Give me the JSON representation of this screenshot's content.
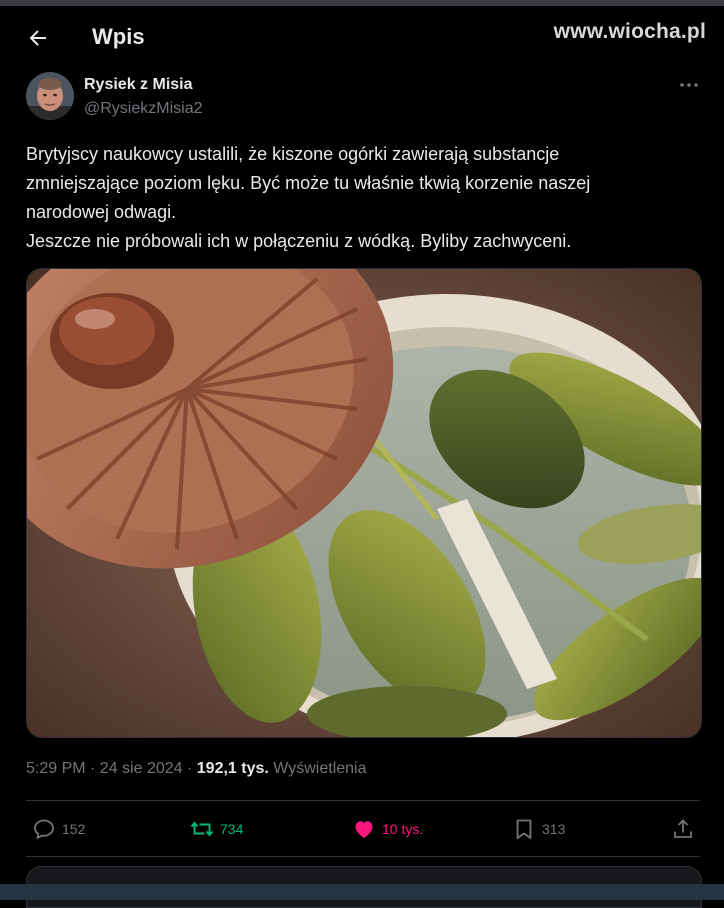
{
  "header": {
    "title": "Wpis",
    "watermark": "www.wiocha.pl"
  },
  "tweet": {
    "author_name": "Rysiek z Misia",
    "author_handle": "@RysiekzMisia2",
    "text_lines": [
      "Brytyjscy naukowcy ustalili, że kiszone ogórki zawierają substancje",
      "zmniejszające poziom lęku. Być może tu właśnie tkwią korzenie naszej",
      "narodowej odwagi.",
      "Jeszcze nie próbowali ich w połączeniu z wódką. Byliby zachwyceni."
    ],
    "timestamp": "5:29 PM · 24 sie 2024 ·",
    "views_count": "192,1 tys.",
    "views_label": "Wyświetlenia"
  },
  "actions": {
    "replies": "152",
    "retweets": "734",
    "likes": "10 tys.",
    "bookmarks": "313"
  },
  "colors": {
    "background": "#000000",
    "text_primary": "#e7e9ea",
    "text_secondary": "#71767b",
    "retweet_green": "#00ba7c",
    "like_pink": "#f91880"
  },
  "icons": {
    "back": "arrow-left-icon",
    "more": "more-dots-icon",
    "reply": "speech-bubble-icon",
    "retweet": "retweet-arrows-icon",
    "like": "heart-icon",
    "bookmark": "bookmark-icon",
    "share": "share-upload-icon"
  }
}
